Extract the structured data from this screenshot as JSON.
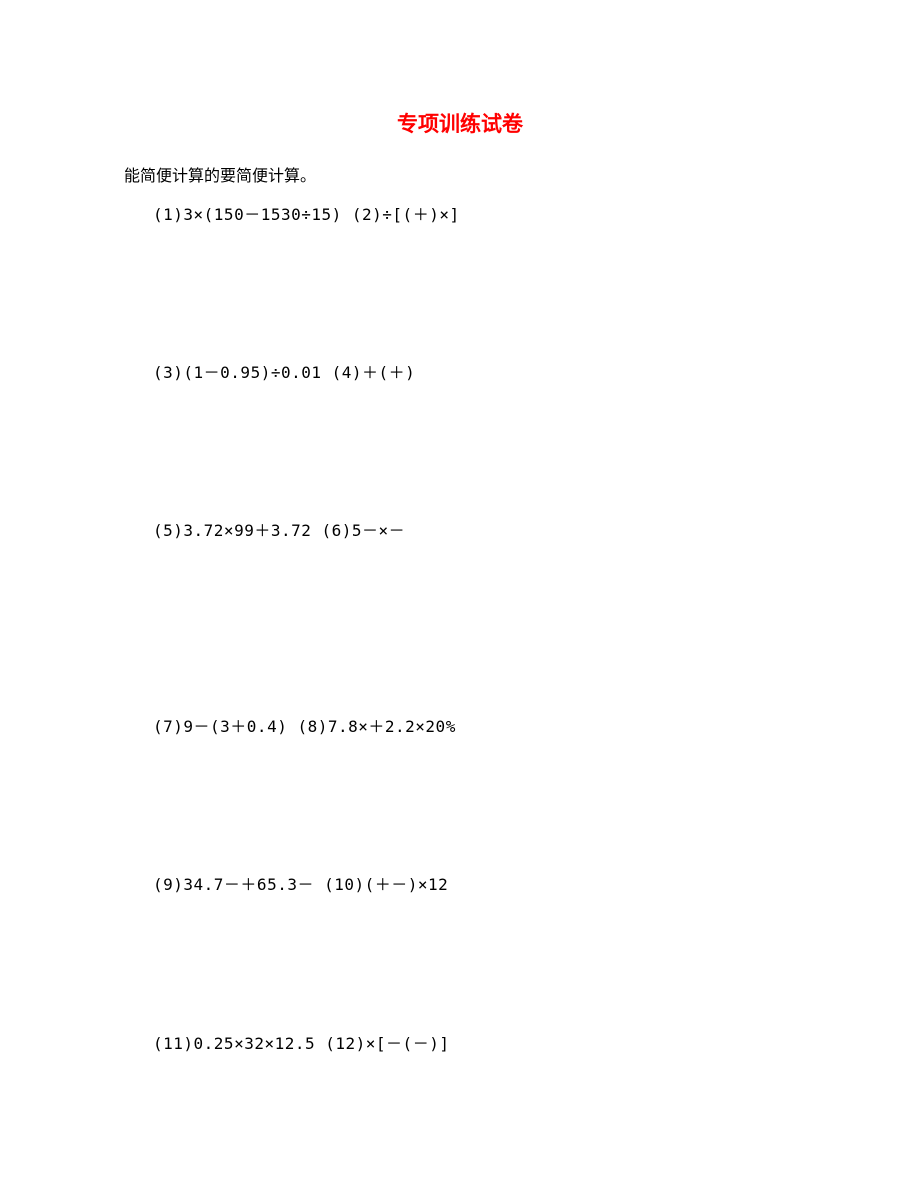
{
  "title": "专项训练试卷",
  "instruction": "能简便计算的要简便计算。",
  "problems": {
    "row1": "(1)3×(150－1530÷15)  (2)÷[(＋)×]",
    "row2": "(3)(1－0.95)÷0.01  (4)＋(＋)",
    "row3": "(5)3.72×99＋3.72  (6)5－×－",
    "row4": "(7)9－(3＋0.4)  (8)7.8×＋2.2×20%",
    "row5": "(9)34.7－＋65.3－  (10)(＋－)×12",
    "row6": "(11)0.25×32×12.5  (12)×[－(－)]"
  }
}
